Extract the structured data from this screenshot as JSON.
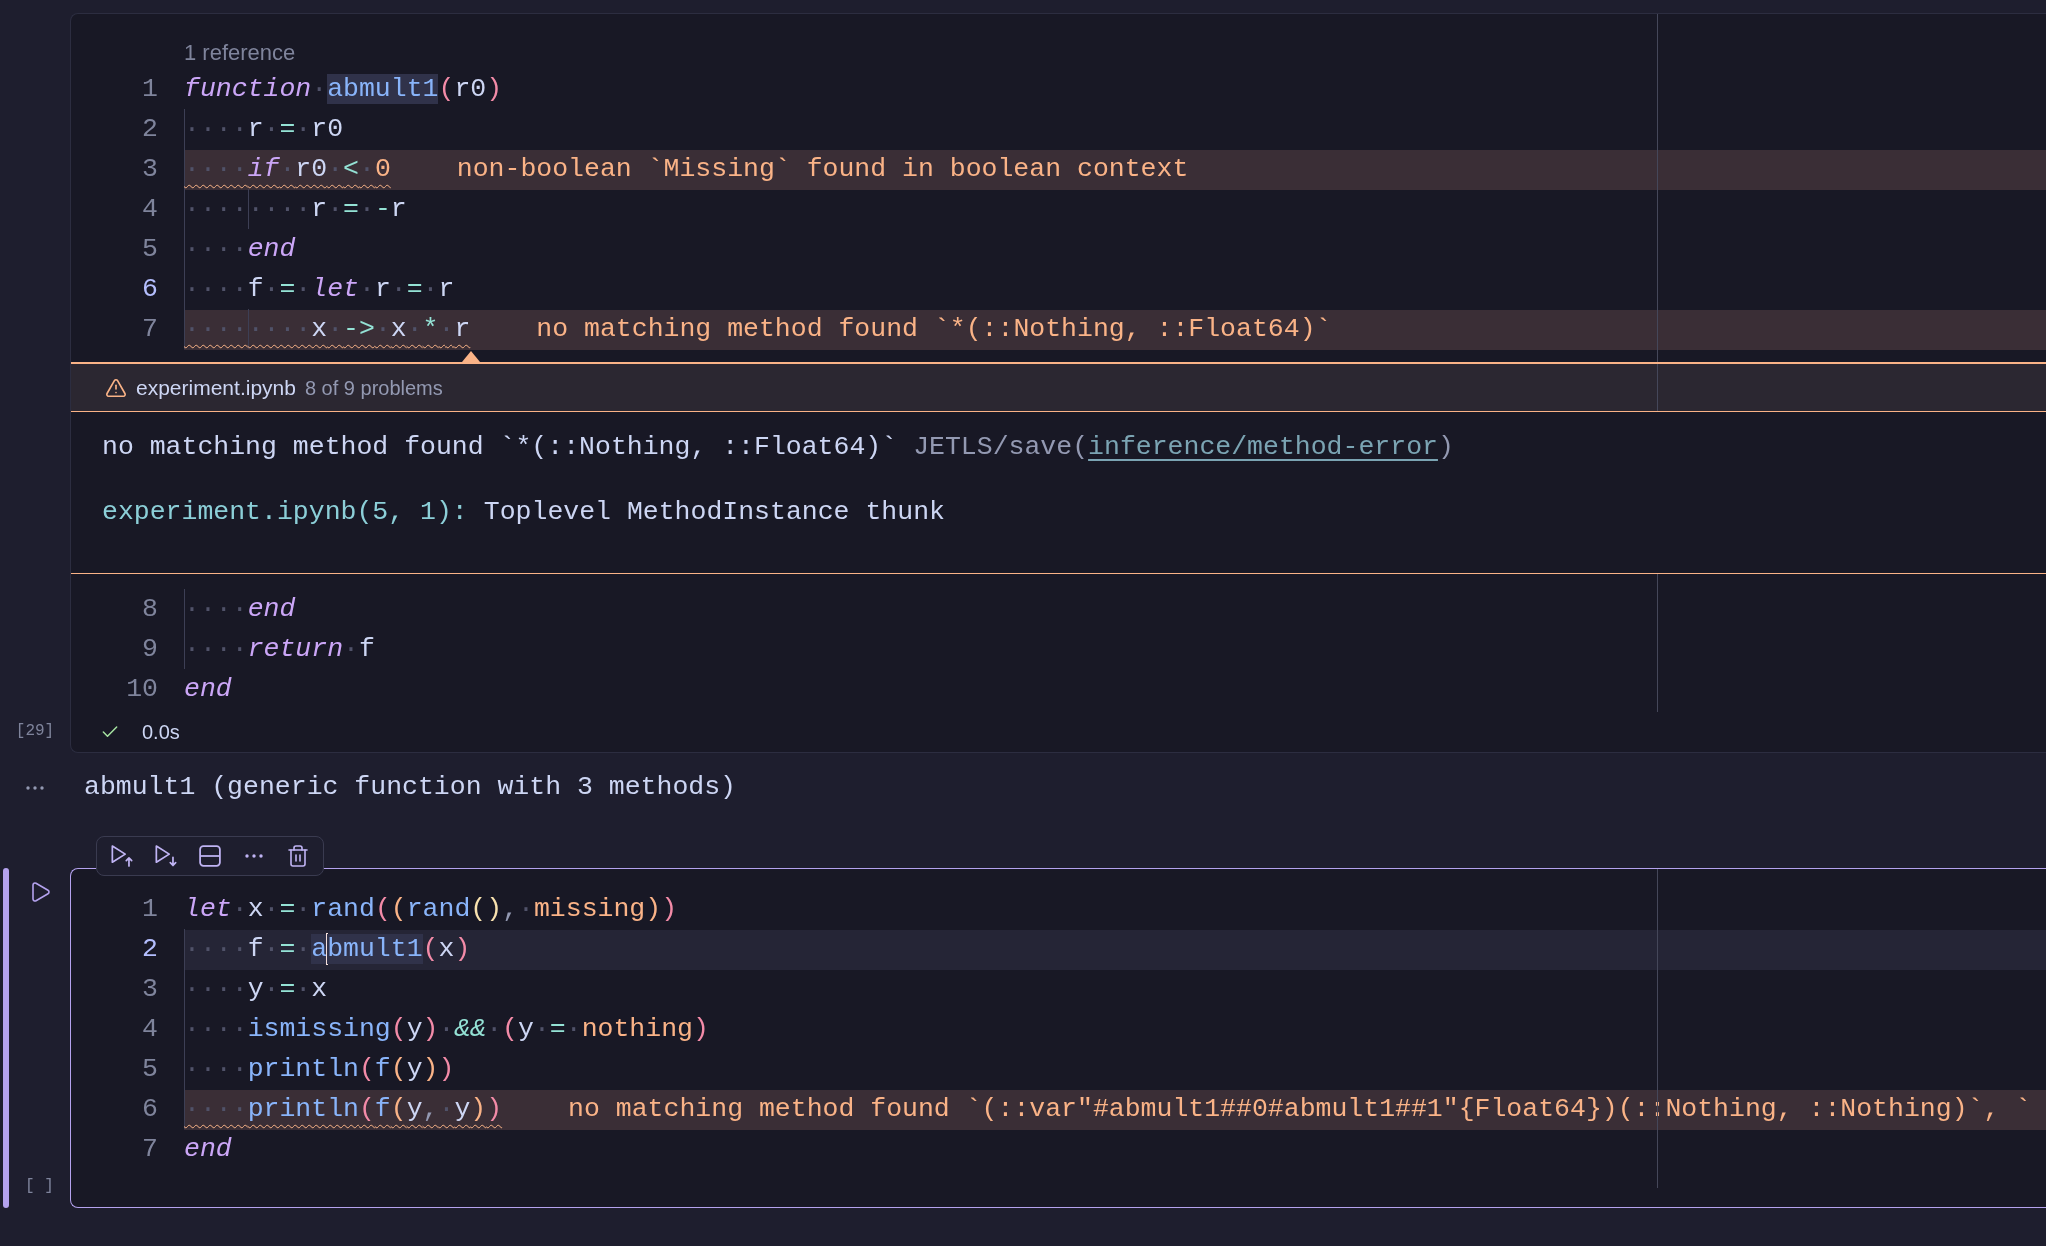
{
  "cells": [
    {
      "selected": false,
      "execution_count": "[29]",
      "code_lens": "1 reference",
      "lines": [
        {
          "number": "1",
          "active": false,
          "current": false,
          "tokens": [
            {
              "kind": "keyword",
              "text": "function"
            },
            {
              "kind": "space",
              "text": "·"
            },
            {
              "kind": "reference",
              "text": "abmult1"
            },
            {
              "kind": "bracket1",
              "text": "("
            },
            {
              "kind": "ident",
              "text": "r0"
            },
            {
              "kind": "bracket1",
              "text": ")"
            }
          ]
        },
        {
          "number": "2",
          "active": false,
          "current": false,
          "tokens": [
            {
              "kind": "indent",
              "text": "····"
            },
            {
              "kind": "ident",
              "text": "r"
            },
            {
              "kind": "space",
              "text": "·"
            },
            {
              "kind": "operator",
              "text": "="
            },
            {
              "kind": "space",
              "text": "·"
            },
            {
              "kind": "ident",
              "text": "r0"
            }
          ]
        },
        {
          "number": "3",
          "active": false,
          "current": false,
          "diagnostic": "non-boolean `Missing` found in boolean context",
          "tokens": [
            {
              "kind": "indent",
              "text": "····"
            },
            {
              "kind": "keyword",
              "text": "if"
            },
            {
              "kind": "space",
              "text": "·"
            },
            {
              "kind": "ident",
              "text": "r0"
            },
            {
              "kind": "space",
              "text": "·"
            },
            {
              "kind": "operator",
              "text": "<"
            },
            {
              "kind": "space",
              "text": "·"
            },
            {
              "kind": "constant",
              "text": "0"
            }
          ]
        },
        {
          "number": "4",
          "active": false,
          "current": false,
          "tokens": [
            {
              "kind": "indent",
              "text": "····"
            },
            {
              "kind": "indent",
              "text": "····"
            },
            {
              "kind": "ident",
              "text": "r"
            },
            {
              "kind": "space",
              "text": "·"
            },
            {
              "kind": "operator",
              "text": "="
            },
            {
              "kind": "space",
              "text": "·"
            },
            {
              "kind": "operator",
              "text": "-"
            },
            {
              "kind": "ident",
              "text": "r"
            }
          ]
        },
        {
          "number": "5",
          "active": false,
          "current": false,
          "tokens": [
            {
              "kind": "indent",
              "text": "····"
            },
            {
              "kind": "keyword",
              "text": "end"
            }
          ]
        },
        {
          "number": "6",
          "active": true,
          "current": false,
          "tokens": [
            {
              "kind": "indent",
              "text": "····"
            },
            {
              "kind": "ident",
              "text": "f"
            },
            {
              "kind": "space",
              "text": "·"
            },
            {
              "kind": "operator",
              "text": "="
            },
            {
              "kind": "space",
              "text": "·"
            },
            {
              "kind": "keyword",
              "text": "let"
            },
            {
              "kind": "space",
              "text": "·"
            },
            {
              "kind": "ident",
              "text": "r"
            },
            {
              "kind": "space",
              "text": "·"
            },
            {
              "kind": "operator",
              "text": "="
            },
            {
              "kind": "space",
              "text": "·"
            },
            {
              "kind": "ident",
              "text": "r"
            }
          ]
        },
        {
          "number": "7",
          "active": false,
          "current": false,
          "diagnostic": "no matching method found `*(::Nothing, ::Float64)`",
          "tokens": [
            {
              "kind": "indent",
              "text": "····"
            },
            {
              "kind": "indent",
              "text": "····"
            },
            {
              "kind": "ident",
              "text": "x"
            },
            {
              "kind": "space",
              "text": "·"
            },
            {
              "kind": "operator",
              "text": "->"
            },
            {
              "kind": "space",
              "text": "·"
            },
            {
              "kind": "ident",
              "text": "x"
            },
            {
              "kind": "space",
              "text": "·"
            },
            {
              "kind": "operator",
              "text": "*"
            },
            {
              "kind": "space",
              "text": "·"
            },
            {
              "kind": "ident",
              "text": "r"
            }
          ]
        }
      ],
      "problem_peek": {
        "file": "experiment.ipynb",
        "count": "8 of 9 problems",
        "message": "no matching method found `*(::Nothing, ::Float64)`",
        "source_prefix": "JETLS/save(",
        "rule_link": "inference/method-error",
        "source_suffix": ")",
        "frame_location": "experiment.ipynb(5, 1):",
        "frame_description": "Toplevel MethodInstance thunk"
      },
      "more_lines": [
        {
          "number": "8",
          "active": false,
          "current": false,
          "tokens": [
            {
              "kind": "indent",
              "text": "····"
            },
            {
              "kind": "keyword",
              "text": "end"
            }
          ]
        },
        {
          "number": "9",
          "active": false,
          "current": false,
          "tokens": [
            {
              "kind": "indent",
              "text": "····"
            },
            {
              "kind": "keyword",
              "text": "return"
            },
            {
              "kind": "space",
              "text": "·"
            },
            {
              "kind": "ident",
              "text": "f"
            }
          ]
        },
        {
          "number": "10",
          "active": false,
          "current": false,
          "tokens": [
            {
              "kind": "keyword",
              "text": "end"
            }
          ]
        }
      ],
      "status": {
        "succeeded": true,
        "duration": "0.0s"
      },
      "output": {
        "text": "abmult1 (generic function with 3 methods)"
      }
    },
    {
      "selected": true,
      "execution_count": "[ ]",
      "toolbar": [
        {
          "kind": "run-above"
        },
        {
          "kind": "run-below"
        },
        {
          "kind": "split"
        },
        {
          "kind": "more"
        },
        {
          "kind": "delete"
        }
      ],
      "lines": [
        {
          "number": "1",
          "active": false,
          "current": false,
          "tokens": [
            {
              "kind": "keyword",
              "text": "let"
            },
            {
              "kind": "space",
              "text": "·"
            },
            {
              "kind": "ident",
              "text": "x"
            },
            {
              "kind": "space",
              "text": "·"
            },
            {
              "kind": "operator",
              "text": "="
            },
            {
              "kind": "space",
              "text": "·"
            },
            {
              "kind": "function",
              "text": "rand"
            },
            {
              "kind": "bracket1",
              "text": "("
            },
            {
              "kind": "bracket2",
              "text": "("
            },
            {
              "kind": "function",
              "text": "rand"
            },
            {
              "kind": "bracket3",
              "text": "()"
            },
            {
              "kind": "punctuation",
              "text": ","
            },
            {
              "kind": "space",
              "text": "·"
            },
            {
              "kind": "constant",
              "text": "missing"
            },
            {
              "kind": "bracket2",
              "text": ")"
            },
            {
              "kind": "bracket1",
              "text": ")"
            }
          ]
        },
        {
          "number": "2",
          "active": true,
          "current": true,
          "tokens": [
            {
              "kind": "indent",
              "text": "····"
            },
            {
              "kind": "ident",
              "text": "f"
            },
            {
              "kind": "space",
              "text": "·"
            },
            {
              "kind": "operator",
              "text": "="
            },
            {
              "kind": "space",
              "text": "·"
            },
            {
              "kind": "reference",
              "text": "a"
            },
            {
              "kind": "caret"
            },
            {
              "kind": "reference",
              "text": "bmult1"
            },
            {
              "kind": "bracket1",
              "text": "("
            },
            {
              "kind": "ident",
              "text": "x"
            },
            {
              "kind": "bracket1",
              "text": ")"
            }
          ]
        },
        {
          "number": "3",
          "active": false,
          "current": false,
          "tokens": [
            {
              "kind": "indent",
              "text": "····"
            },
            {
              "kind": "ident",
              "text": "y"
            },
            {
              "kind": "space",
              "text": "·"
            },
            {
              "kind": "operator",
              "text": "="
            },
            {
              "kind": "space",
              "text": "·"
            },
            {
              "kind": "ident",
              "text": "x"
            }
          ]
        },
        {
          "number": "4",
          "active": false,
          "current": false,
          "tokens": [
            {
              "kind": "indent",
              "text": "····"
            },
            {
              "kind": "function",
              "text": "ismissing"
            },
            {
              "kind": "bracket1",
              "text": "("
            },
            {
              "kind": "ident",
              "text": "y"
            },
            {
              "kind": "bracket1",
              "text": ")"
            },
            {
              "kind": "space",
              "text": "·"
            },
            {
              "kind": "logical",
              "text": "&&"
            },
            {
              "kind": "space",
              "text": "·"
            },
            {
              "kind": "bracket1",
              "text": "("
            },
            {
              "kind": "ident",
              "text": "y"
            },
            {
              "kind": "space",
              "text": "·"
            },
            {
              "kind": "operator",
              "text": "="
            },
            {
              "kind": "space",
              "text": "·"
            },
            {
              "kind": "constant",
              "text": "nothing"
            },
            {
              "kind": "bracket1",
              "text": ")"
            }
          ]
        },
        {
          "number": "5",
          "active": false,
          "current": false,
          "tokens": [
            {
              "kind": "indent",
              "text": "····"
            },
            {
              "kind": "function",
              "text": "println"
            },
            {
              "kind": "bracket1",
              "text": "("
            },
            {
              "kind": "function",
              "text": "f"
            },
            {
              "kind": "bracket2",
              "text": "("
            },
            {
              "kind": "ident",
              "text": "y"
            },
            {
              "kind": "bracket2",
              "text": ")"
            },
            {
              "kind": "bracket1",
              "text": ")"
            }
          ]
        },
        {
          "number": "6",
          "active": false,
          "current": false,
          "diagnostic": "no matching method found `(::var\"#abmult1##0#abmult1##1\"{Float64})(::Nothing, ::Nothing)`, `",
          "tokens": [
            {
              "kind": "indent",
              "text": "····"
            },
            {
              "kind": "function",
              "text": "println"
            },
            {
              "kind": "bracket1",
              "text": "("
            },
            {
              "kind": "function",
              "text": "f"
            },
            {
              "kind": "bracket2",
              "text": "("
            },
            {
              "kind": "ident",
              "text": "y"
            },
            {
              "kind": "punctuation",
              "text": ","
            },
            {
              "kind": "space",
              "text": "·"
            },
            {
              "kind": "ident",
              "text": "y"
            },
            {
              "kind": "bracket2",
              "text": ")"
            },
            {
              "kind": "bracket1",
              "text": ")"
            }
          ]
        },
        {
          "number": "7",
          "active": false,
          "current": false,
          "tokens": [
            {
              "kind": "keyword",
              "text": "end"
            }
          ]
        }
      ]
    }
  ]
}
